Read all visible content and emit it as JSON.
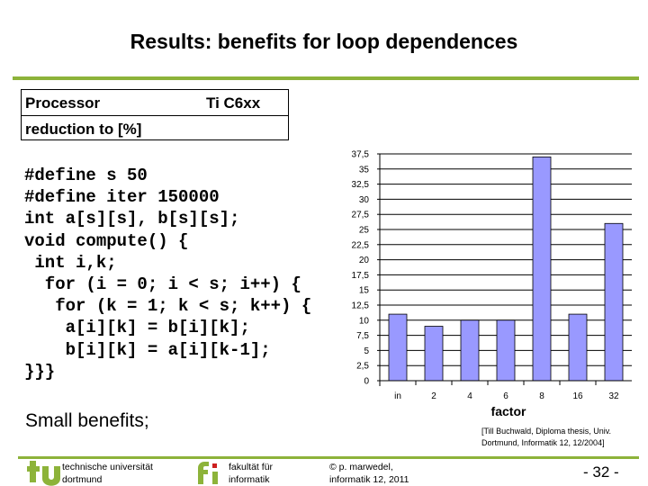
{
  "slide": {
    "title": "Results: benefits for loop dependences",
    "table": {
      "row1_label": "Processor",
      "row1_value": "Ti C6xx",
      "row2_label": "reduction to [%]"
    },
    "code_lines": [
      "#define s 50",
      "#define iter 150000",
      "int a[s][s], b[s][s];",
      "void compute() {",
      " int i,k;",
      "  for (i = 0; i < s; i++) {",
      "   for (k = 1; k < s; k++) {",
      "    a[i][k] = b[i][k];",
      "    b[i][k] = a[i][k-1];",
      "}}}"
    ],
    "conclusion": "Small benefits;",
    "citation_line1": "[Till Buchwald, Diploma thesis, Univ.",
    "citation_line2": "Dortmund, Informatik 12, 12/2004]",
    "accent_color": "#8db33a"
  },
  "footer": {
    "tu_line1": "technische universität",
    "tu_line2": "dortmund",
    "fi_line1": "fakultät für",
    "fi_line2": "informatik",
    "copy_line1": "© p. marwedel,",
    "copy_line2": "informatik 12,  2011",
    "page": "- 32 -"
  },
  "chart_data": {
    "type": "bar",
    "title": "",
    "xlabel": "factor",
    "ylabel": "",
    "categories": [
      "in",
      "2",
      "4",
      "6",
      "8",
      "16",
      "32"
    ],
    "values": [
      11,
      9,
      10,
      10,
      37,
      11,
      26
    ],
    "ylim": [
      0,
      37.5
    ],
    "yticks": [
      0,
      2.5,
      5,
      7.5,
      10,
      12.5,
      15,
      17.5,
      20,
      22.5,
      25,
      27.5,
      30,
      32.5,
      35,
      37.5
    ],
    "ytick_labels": [
      "0",
      "2,5",
      "5",
      "7,5",
      "10",
      "12,5",
      "15",
      "17,5",
      "20",
      "22,5",
      "25",
      "27,5",
      "30",
      "32,5",
      "35",
      "37,5"
    ],
    "grid": true,
    "legend": "none",
    "bar_color": "#9999ff"
  }
}
